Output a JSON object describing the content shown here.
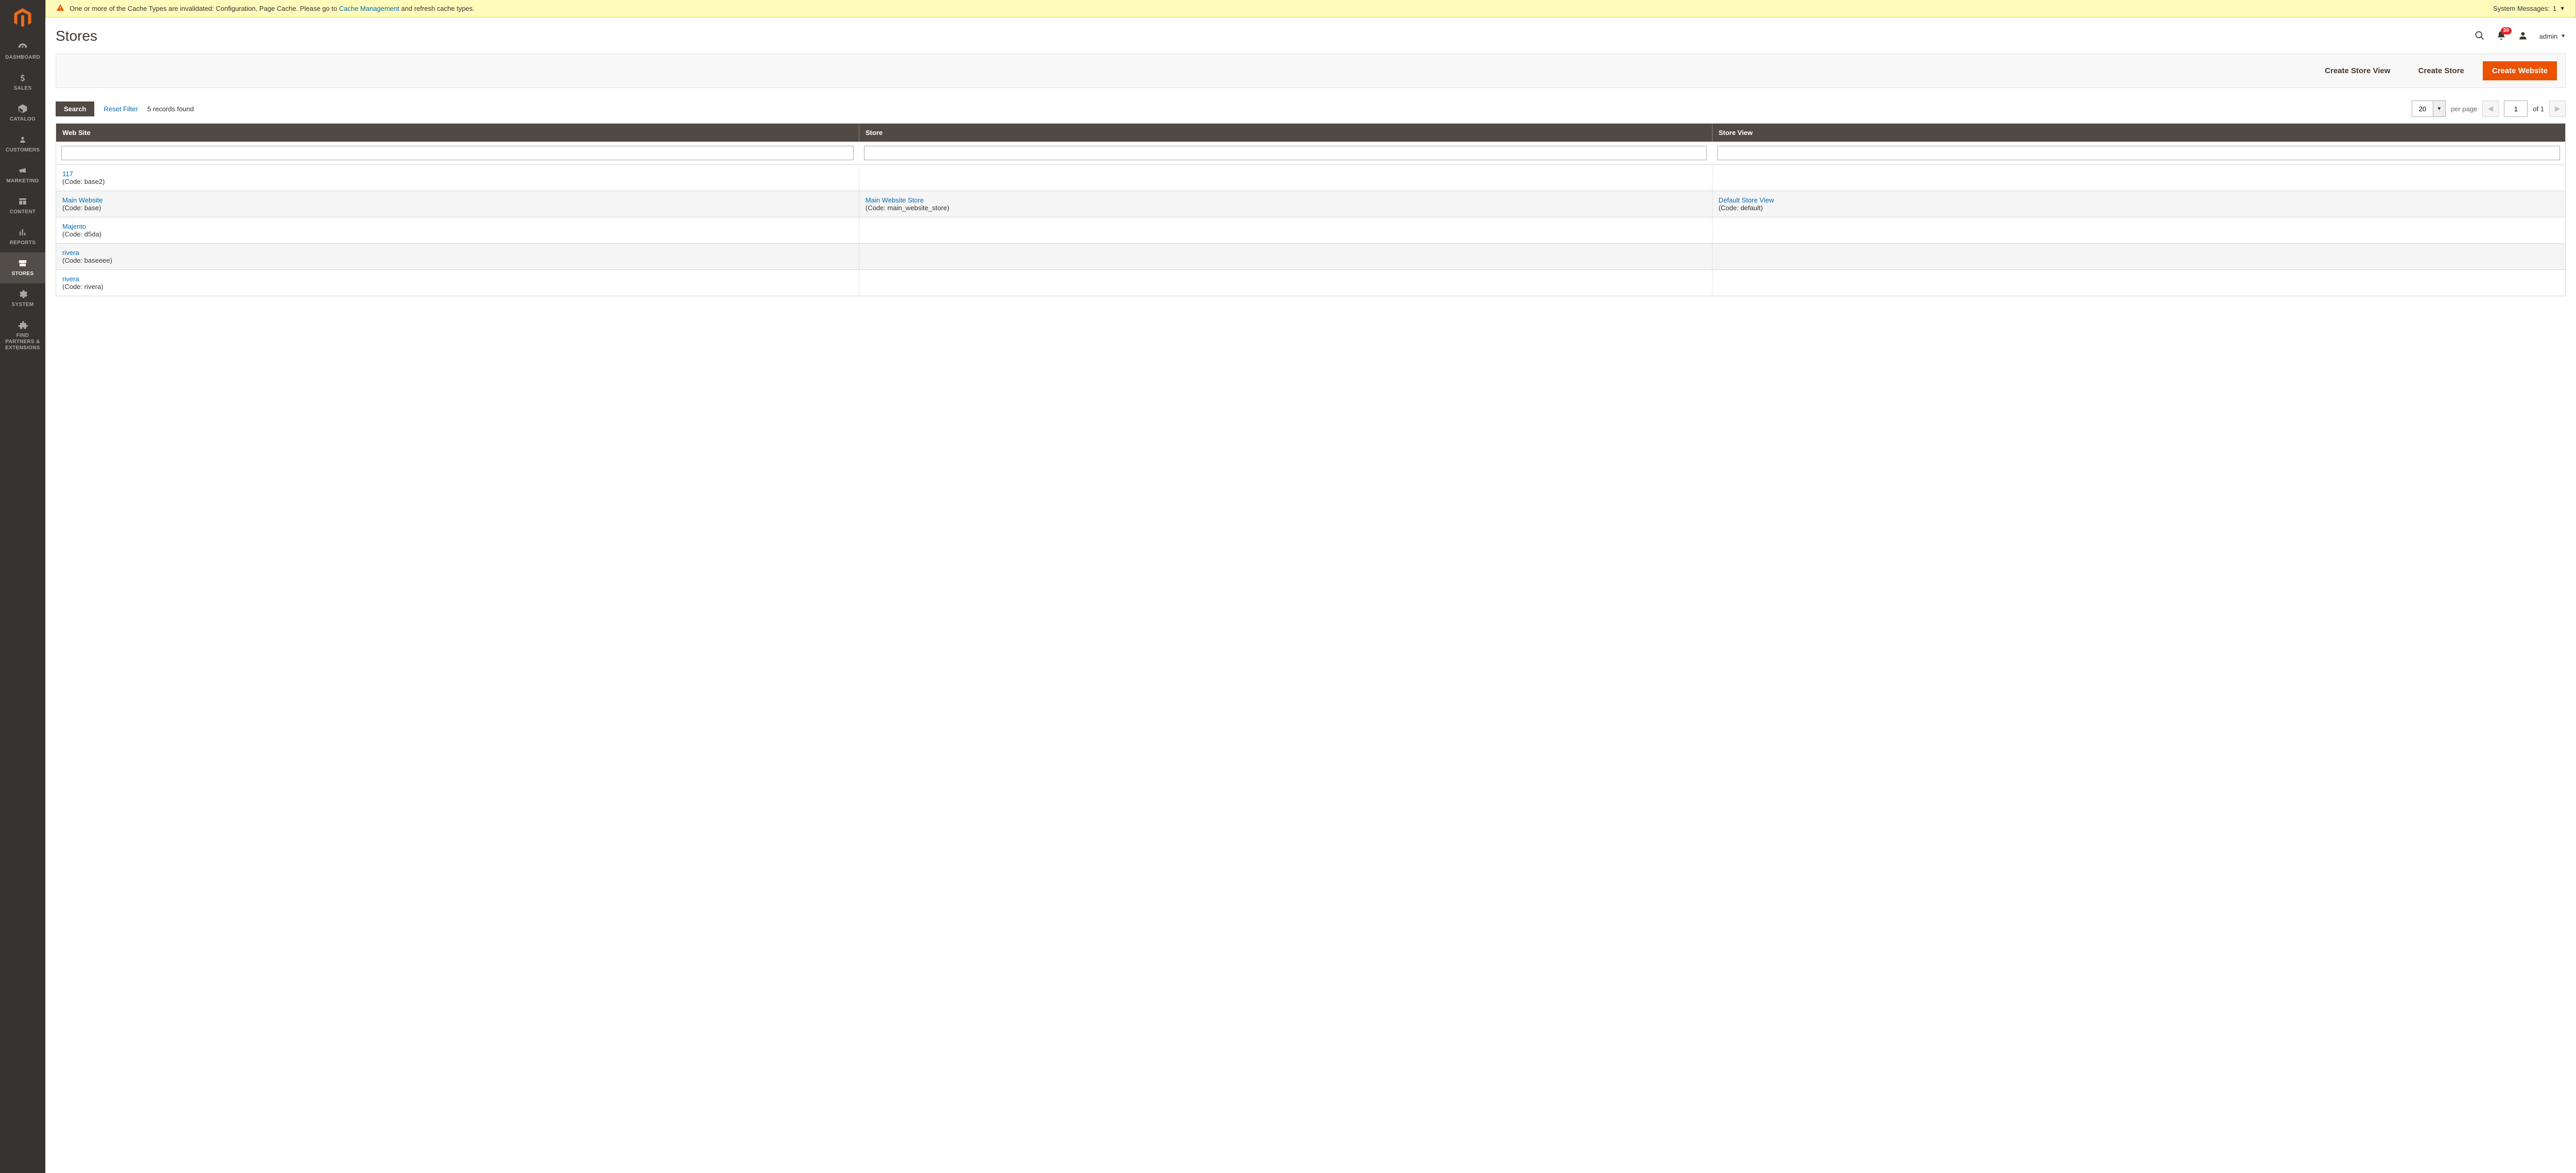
{
  "sidebar": {
    "items": [
      {
        "key": "dashboard",
        "label": "DASHBOARD"
      },
      {
        "key": "sales",
        "label": "SALES"
      },
      {
        "key": "catalog",
        "label": "CATALOG"
      },
      {
        "key": "customers",
        "label": "CUSTOMERS"
      },
      {
        "key": "marketing",
        "label": "MARKETING"
      },
      {
        "key": "content",
        "label": "CONTENT"
      },
      {
        "key": "reports",
        "label": "REPORTS"
      },
      {
        "key": "stores",
        "label": "STORES"
      },
      {
        "key": "system",
        "label": "SYSTEM"
      },
      {
        "key": "partners",
        "label": "FIND PARTNERS & EXTENSIONS"
      }
    ]
  },
  "system_message": {
    "prefix": "One or more of the Cache Types are invalidated: Configuration, Page Cache. Please go to ",
    "link": "Cache Management",
    "suffix": " and refresh cache types.",
    "counter_label": "System Messages:",
    "counter_value": "1"
  },
  "page": {
    "title": "Stores"
  },
  "topbar": {
    "notif_count": "39",
    "username": "admin"
  },
  "actions": {
    "create_store_view": "Create Store View",
    "create_store": "Create Store",
    "create_website": "Create Website"
  },
  "controls": {
    "search": "Search",
    "reset": "Reset Filter",
    "records": "5 records found",
    "page_size": "20",
    "per_page": "per page",
    "page": "1",
    "of_label": "of",
    "total_pages": "1"
  },
  "grid": {
    "headers": {
      "website": "Web Site",
      "store": "Store",
      "view": "Store View"
    },
    "rows": [
      {
        "website": {
          "name": "117",
          "code": "(Code: base2)"
        },
        "store": null,
        "view": null
      },
      {
        "website": {
          "name": "Main Website",
          "code": "(Code: base)"
        },
        "store": {
          "name": "Main Website Store",
          "code": "(Code: main_website_store)"
        },
        "view": {
          "name": "Default Store View",
          "code": "(Code: default)"
        }
      },
      {
        "website": {
          "name": "Majento",
          "code": "(Code: d5da)"
        },
        "store": null,
        "view": null
      },
      {
        "website": {
          "name": "rivera",
          "code": "(Code: baseeee)"
        },
        "store": null,
        "view": null
      },
      {
        "website": {
          "name": "rivera",
          "code": "(Code: rivera)"
        },
        "store": null,
        "view": null
      }
    ]
  }
}
